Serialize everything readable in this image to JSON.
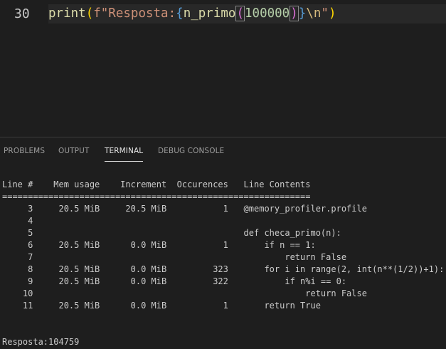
{
  "editor": {
    "line_number": "30",
    "code": {
      "fn": "print",
      "open_paren": "(",
      "str_prefix": "f\"Resposta:",
      "brace_open": "{",
      "call_name": "n_primo",
      "call_open": "(",
      "arg": "100000",
      "call_close": ")",
      "brace_close": "}",
      "escape": "\\n",
      "str_end": "\"",
      "close_paren": ")"
    }
  },
  "panel": {
    "tabs": [
      {
        "label": "PROBLEMS",
        "active": false
      },
      {
        "label": "OUTPUT",
        "active": false
      },
      {
        "label": "TERMINAL",
        "active": true
      },
      {
        "label": "DEBUG CONSOLE",
        "active": false
      }
    ],
    "terminal": {
      "header": "Line #    Mem usage    Increment  Occurences   Line Contents",
      "separator": "============================================================",
      "rows": [
        "     3     20.5 MiB     20.5 MiB           1   @memory_profiler.profile",
        "     4",
        "     5                                         def checa_primo(n):",
        "     6     20.5 MiB      0.0 MiB           1       if n == 1:",
        "     7                                                 return False",
        "     8     20.5 MiB      0.0 MiB         323       for i in range(2, int(n**(1/2))+1):",
        "     9     20.5 MiB      0.0 MiB         322           if n%i == 0:",
        "    10                                                     return False",
        "    11     20.5 MiB      0.0 MiB           1       return True"
      ],
      "result": "Resposta:104759"
    }
  }
}
